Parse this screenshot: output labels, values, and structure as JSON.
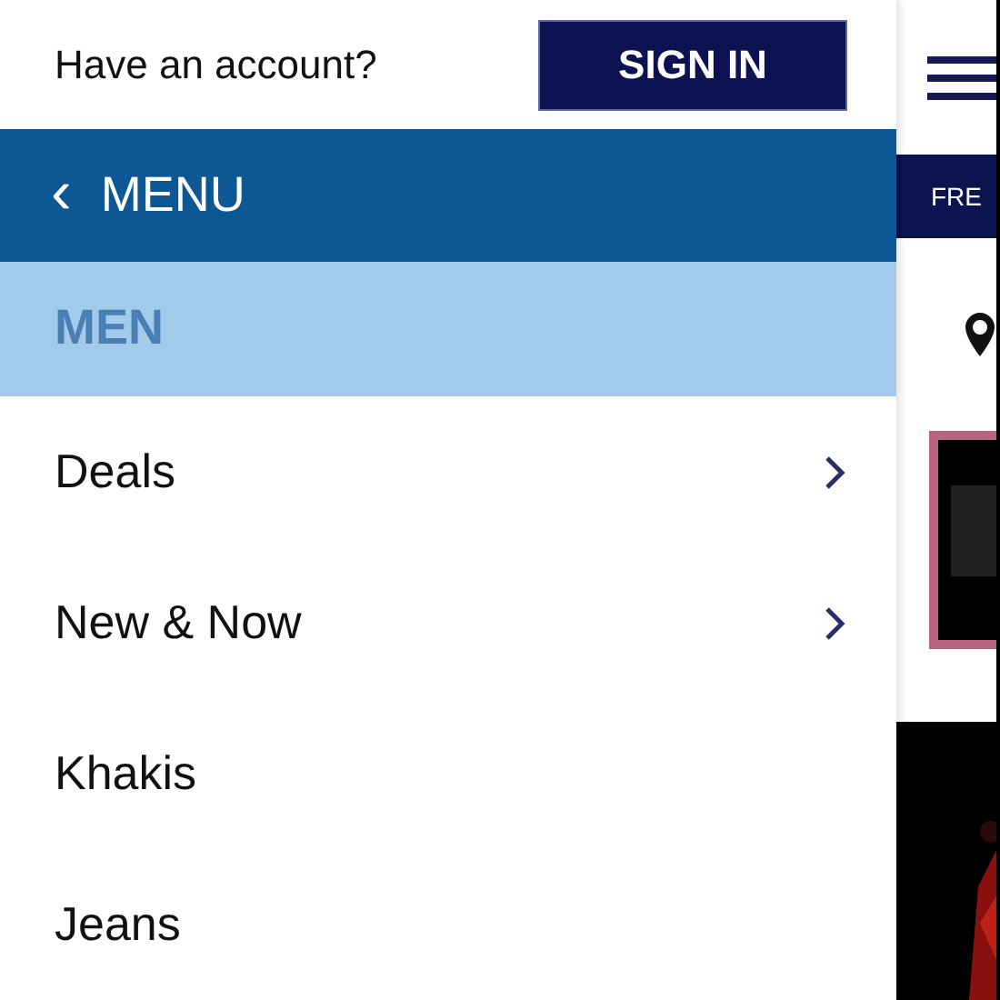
{
  "account": {
    "prompt": "Have an account?",
    "button": "SIGN IN"
  },
  "menu_header": {
    "back_icon": "‹",
    "title": "MENU"
  },
  "category": {
    "title": "MEN"
  },
  "items": [
    {
      "label": "Deals",
      "has_children": true
    },
    {
      "label": "New & Now",
      "has_children": true
    },
    {
      "label": "Khakis",
      "has_children": false
    },
    {
      "label": "Jeans",
      "has_children": false
    }
  ],
  "background_page": {
    "banner": "FRE"
  }
}
